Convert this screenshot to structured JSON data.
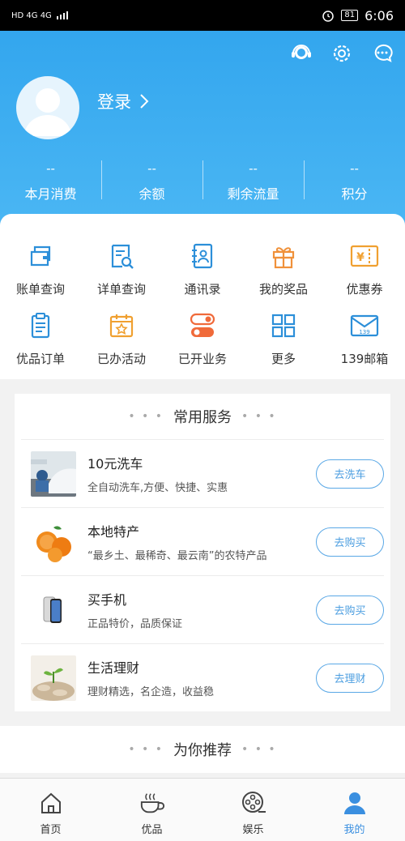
{
  "statusbar": {
    "left_text": "HD 4G 4G",
    "battery": "81",
    "time": "6:06"
  },
  "header": {
    "login_label": "登录",
    "stats": [
      {
        "value": "--",
        "label": "本月消费"
      },
      {
        "value": "--",
        "label": "余额"
      },
      {
        "value": "--",
        "label": "剩余流量"
      },
      {
        "value": "--",
        "label": "积分"
      }
    ]
  },
  "grid": {
    "row1": [
      {
        "label": "账单查询",
        "icon": "bill-icon"
      },
      {
        "label": "详单查询",
        "icon": "detail-search-icon"
      },
      {
        "label": "通讯录",
        "icon": "contacts-icon"
      },
      {
        "label": "我的奖品",
        "icon": "gift-icon"
      },
      {
        "label": "优惠券",
        "icon": "coupon-icon"
      }
    ],
    "row2": [
      {
        "label": "优品订单",
        "icon": "clipboard-icon"
      },
      {
        "label": "已办活动",
        "icon": "calendar-star-icon"
      },
      {
        "label": "已开业务",
        "icon": "toggle-icon"
      },
      {
        "label": "更多",
        "icon": "more-grid-icon"
      },
      {
        "label": "139邮箱",
        "icon": "mail-icon"
      }
    ],
    "mail_badge": "139"
  },
  "services": {
    "title": "常用服务",
    "items": [
      {
        "title": "10元洗车",
        "subtitle": "全自动洗车,方便、快捷、实惠",
        "button": "去洗车"
      },
      {
        "title": "本地特产",
        "subtitle": "“最乡土、最稀奇、最云南”的农特产品",
        "button": "去购买"
      },
      {
        "title": "买手机",
        "subtitle": "正品特价，品质保证",
        "button": "去购买"
      },
      {
        "title": "生活理财",
        "subtitle": "理财精选，名企造，收益稳",
        "button": "去理财"
      }
    ]
  },
  "recommend": {
    "title": "为你推荐"
  },
  "tabbar": {
    "tabs": [
      {
        "label": "首页"
      },
      {
        "label": "优品"
      },
      {
        "label": "娱乐"
      },
      {
        "label": "我的"
      }
    ]
  },
  "colors": {
    "header_blue": "#3aa9f0",
    "accent": "#3a8fe0",
    "orange": "#f0913a"
  }
}
